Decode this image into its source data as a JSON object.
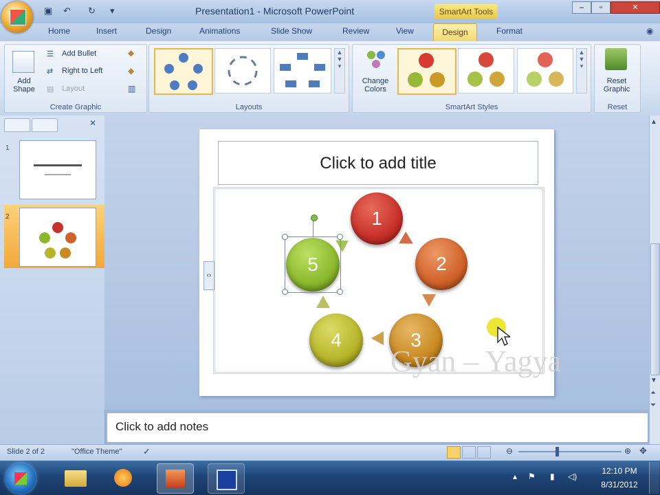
{
  "window": {
    "title": "Presentation1 - Microsoft PowerPoint",
    "context_tab_title": "SmartArt Tools"
  },
  "tabs": [
    "Home",
    "Insert",
    "Design",
    "Animations",
    "Slide Show",
    "Review",
    "View",
    "Design",
    "Format"
  ],
  "ribbon": {
    "create_graphic": {
      "label": "Create Graphic",
      "add_shape": "Add Shape",
      "add_bullet": "Add Bullet",
      "right_to_left": "Right to Left",
      "layout": "Layout"
    },
    "layouts": {
      "label": "Layouts"
    },
    "smartart_styles": {
      "label": "SmartArt Styles",
      "change_colors": "Change Colors"
    },
    "reset": {
      "label": "Reset",
      "reset_graphic": "Reset Graphic"
    }
  },
  "slide": {
    "title_placeholder": "Click to add title",
    "cycle": [
      "1",
      "2",
      "3",
      "4",
      "5"
    ],
    "watermark": "Gyan – Yagya"
  },
  "notes_placeholder": "Click to add notes",
  "status": {
    "slide_info": "Slide 2 of 2",
    "theme": "\"Office Theme\""
  },
  "taskbar": {
    "time": "12:10 PM",
    "date": "8/31/2012"
  },
  "colors": {
    "circle1": "#c8302a",
    "circle2": "#d0622a",
    "circle3": "#c98a22",
    "circle4": "#b6b52a",
    "circle5": "#8bb82c"
  }
}
